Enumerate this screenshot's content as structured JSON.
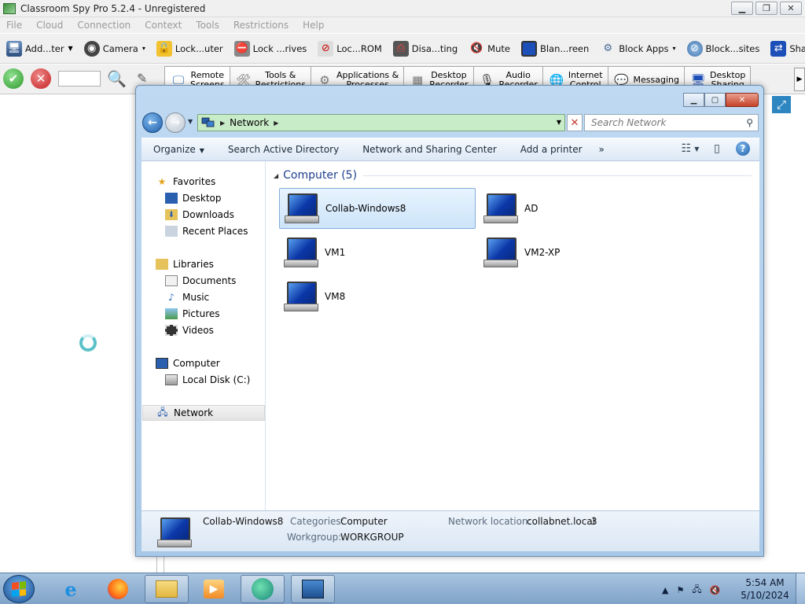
{
  "app": {
    "title": "Classroom Spy Pro 5.2.4 - Unregistered",
    "menu": [
      "File",
      "Cloud",
      "Connection",
      "Context",
      "Tools",
      "Restrictions",
      "Help"
    ],
    "toolbar": [
      {
        "label": "Add...ter",
        "icon": "add-computer-icon",
        "dropdown": true
      },
      {
        "label": "Camera",
        "icon": "camera-icon",
        "dropdown": true
      },
      {
        "label": "Lock...uter",
        "icon": "lock-icon",
        "dropdown": false
      },
      {
        "label": "Lock ...rives",
        "icon": "lock-drives-icon",
        "dropdown": false
      },
      {
        "label": "Loc...ROM",
        "icon": "lock-cdrom-icon",
        "dropdown": false
      },
      {
        "label": "Disa...ting",
        "icon": "disable-printing-icon",
        "dropdown": false
      },
      {
        "label": "Mute",
        "icon": "mute-icon",
        "dropdown": false
      },
      {
        "label": "Blan...reen",
        "icon": "blank-screen-icon",
        "dropdown": false
      },
      {
        "label": "Block Apps",
        "icon": "block-apps-icon",
        "dropdown": true
      },
      {
        "label": "Block...sites",
        "icon": "block-websites-icon",
        "dropdown": false
      },
      {
        "label": "Shar...ktop",
        "icon": "share-desktop-icon",
        "dropdown": false
      }
    ],
    "tabs": [
      {
        "label": "Remote\nScreens",
        "icon": "remote-screens-icon"
      },
      {
        "label": "Tools &\nRestrictions",
        "icon": "tools-icon"
      },
      {
        "label": "Applications &\nProcesses",
        "icon": "applications-icon"
      },
      {
        "label": "Desktop\nRecorder",
        "icon": "recorder-icon"
      },
      {
        "label": "Audio\nRecorder",
        "icon": "microphone-icon"
      },
      {
        "label": "Internet\nControl",
        "icon": "internet-icon"
      },
      {
        "label": "Messaging",
        "icon": "messaging-icon"
      },
      {
        "label": "Desktop\nSharing",
        "icon": "desktop-sharing-icon"
      }
    ]
  },
  "explorer": {
    "address": {
      "crumb": "Network"
    },
    "search_placeholder": "Search Network",
    "commands": {
      "organize": "Organize",
      "search_ad": "Search Active Directory",
      "network_center": "Network and Sharing Center",
      "add_printer": "Add a printer",
      "more": "»"
    },
    "nav": {
      "favorites": "Favorites",
      "desktop": "Desktop",
      "downloads": "Downloads",
      "recent": "Recent Places",
      "libraries": "Libraries",
      "documents": "Documents",
      "music": "Music",
      "pictures": "Pictures",
      "videos": "Videos",
      "computer": "Computer",
      "local_disk": "Local Disk (C:)",
      "network": "Network"
    },
    "group_title": "Computer (5)",
    "computers": [
      "Collab-Windows8",
      "AD",
      "VM1",
      "VM2-XP",
      "VM8"
    ],
    "status": {
      "name": "Collab-Windows8",
      "categories_label": "Categories:",
      "categories_value": "Computer",
      "workgroup_label": "Workgroup:",
      "workgroup_value": "WORKGROUP",
      "location_label": "Network location:",
      "location_value": "collabnet.local",
      "location_count": "3"
    }
  },
  "taskbar": {
    "time": "5:54 AM",
    "date": "5/10/2024"
  }
}
